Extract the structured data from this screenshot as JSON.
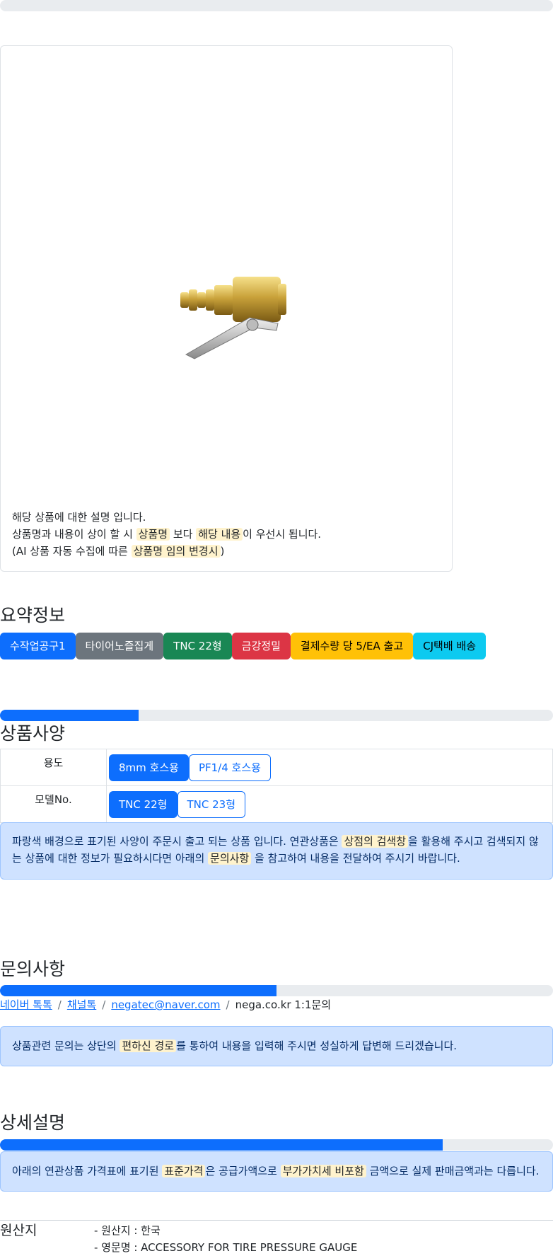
{
  "progress": {
    "top_bar": 0,
    "spec_bar": 0.25,
    "inquiry_bar": 0.5,
    "detail_bar": 0.8
  },
  "product": {
    "image_alt": "",
    "desc_line1": "해당 상품에 대한 설명 입니다.",
    "desc_line2_a": "상품명과 내용이 상이 할 시 ",
    "desc_line2_mark1": "상품명",
    "desc_line2_b": " 보다 ",
    "desc_line2_mark2": "해당 내용",
    "desc_line2_c": "이 우선시 됩니다.",
    "desc_line3_a": "(AI 상품 자동 수집에 따른 ",
    "desc_line3_mark": "상품명 임의 변경시",
    "desc_line3_b": ")"
  },
  "summary": {
    "title": "요약정보",
    "badges": [
      "수작업공구1",
      "타이어노즐집게",
      "TNC 22형",
      "금강정밀",
      "결제수량 당 5/EA 출고",
      "CJ택배 배송"
    ]
  },
  "spec": {
    "title": "상품사양",
    "rows": [
      {
        "label": "용도",
        "options": [
          "8mm 호스용",
          "PF1/4 호스용"
        ]
      },
      {
        "label": "모델No.",
        "options": [
          "TNC 22형",
          "TNC 23형"
        ]
      }
    ],
    "notice_a": "파랑색 배경으로 표기된 사양이 주문시 출고 되는 상품 입니다. 연관상품은 ",
    "notice_mark1": "상점의 검색창",
    "notice_b": "을 활용해 주시고 검색되지 않는 상품에 대한 정보가 필요하시다면 아래의 ",
    "notice_mark2": "문의사항",
    "notice_c": " 을 참고하여 내용을 전달하여 주시기 바랍니다."
  },
  "inquiry": {
    "title": "문의사항",
    "links": [
      "네이버 톡톡",
      "채널톡",
      "negatec@naver.com"
    ],
    "sep": "/",
    "last": "nega.co.kr 1:1문의",
    "notice_a": "상품관련 문의는 상단의 ",
    "notice_mark": "편하신 경로",
    "notice_b": "를 통하여 내용을 입력해 주시면 성실하게 답변해 드리겠습니다."
  },
  "detail": {
    "title": "상세설명",
    "notice_a": "아래의 연관상품 가격표에 표기된 ",
    "notice_mark1": "표준가격",
    "notice_b": "은 공급가액으로 ",
    "notice_mark2": "부가가치세 비포함",
    "notice_c": " 금액으로 실제 판매금액과는 다릅니다."
  },
  "origin": {
    "label": "원산지",
    "items": [
      "- 원산지 : 한국",
      "- 영문명 : ACCESSORY FOR TIRE PRESSURE GAUGE"
    ]
  },
  "colors": {
    "primary": "#0d6efd",
    "alert_bg": "#cfe2ff",
    "mark_bg": "#fff3cd"
  }
}
